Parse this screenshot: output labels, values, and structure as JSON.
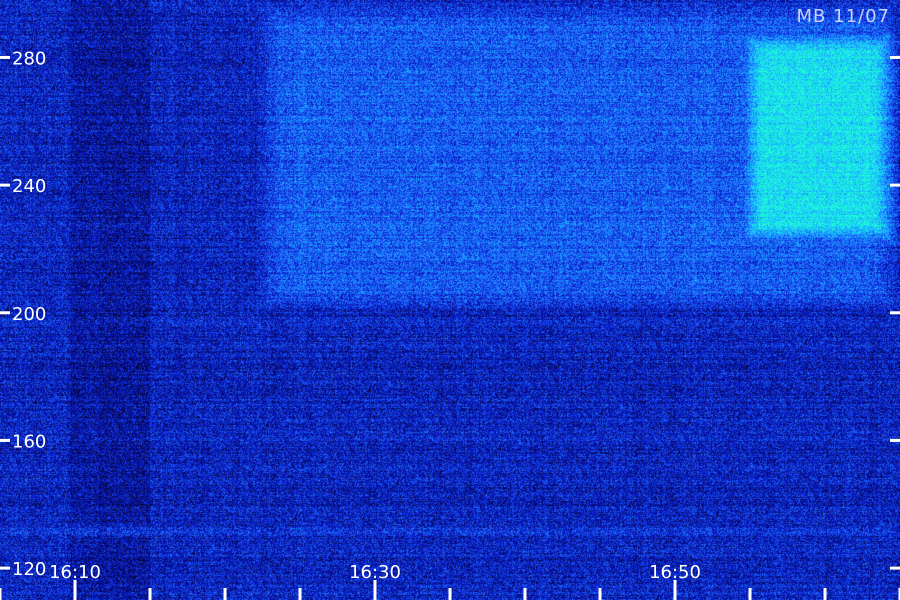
{
  "chart_data": {
    "type": "heatmap",
    "title": "",
    "station_label": "MB 11/07",
    "xlabel": "",
    "ylabel": "",
    "x_tick_labels": [
      "16:10",
      "16:30",
      "16:50"
    ],
    "x_range": [
      "16:05",
      "17:05"
    ],
    "y_range": [
      110,
      298
    ],
    "y_ticks": [
      120,
      160,
      200,
      240,
      280
    ],
    "colormap": [
      "#05053a",
      "#0a18c8",
      "#1e6cff",
      "#18c8ff",
      "#20ffd0"
    ],
    "grid": false,
    "features": [
      {
        "name": "broadband enhancement",
        "x_start": "16:22",
        "x_end": "17:05",
        "y_start": 200,
        "y_end": 298,
        "level": 0.45
      },
      {
        "name": "bright patch",
        "x_start": "16:54",
        "x_end": "17:05",
        "y_start": 220,
        "y_end": 290,
        "level": 0.85
      },
      {
        "name": "horizontal line",
        "x_start": "16:05",
        "x_end": "17:05",
        "y_start": 130,
        "y_end": 134,
        "level": 0.6
      }
    ]
  }
}
